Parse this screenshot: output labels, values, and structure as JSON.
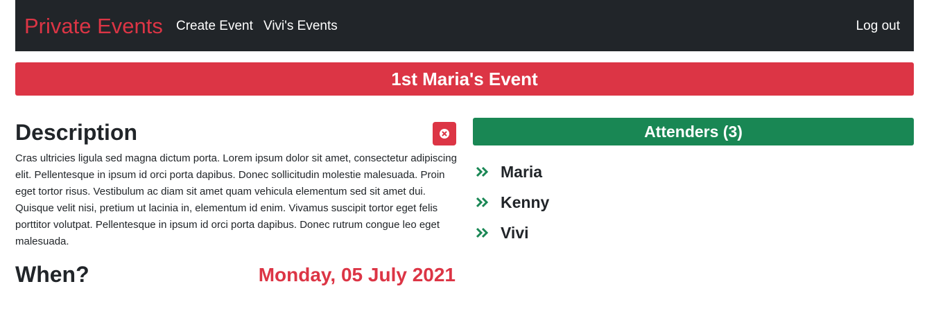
{
  "navbar": {
    "brand": "Private Events",
    "links": [
      {
        "label": "Create Event"
      },
      {
        "label": "Vivi's Events"
      }
    ],
    "logout_label": "Log out"
  },
  "event": {
    "title": "1st Maria's Event",
    "description_heading": "Description",
    "description": "Cras ultricies ligula sed magna dictum porta. Lorem ipsum dolor sit amet, consectetur adipiscing elit. Pellentesque in ipsum id orci porta dapibus. Donec sollicitudin molestie malesuada. Proin eget tortor risus. Vestibulum ac diam sit amet quam vehicula elementum sed sit amet dui. Quisque velit nisi, pretium ut lacinia in, elementum id enim. Vivamus suscipit tortor eget felis porttitor volutpat. Pellentesque in ipsum id orci porta dapibus. Donec rutrum congue leo eget malesuada.",
    "when_heading": "When?",
    "date": "Monday, 05 July 2021",
    "delete_icon": "times-circle-icon"
  },
  "attenders": {
    "heading": "Attenders (3)",
    "bullet_icon": "double-chevron-right-icon",
    "items": [
      {
        "name": "Maria"
      },
      {
        "name": "Kenny"
      },
      {
        "name": "Vivi"
      }
    ]
  },
  "colors": {
    "navbar_bg": "#212529",
    "danger": "#dc3545",
    "success": "#198754"
  }
}
